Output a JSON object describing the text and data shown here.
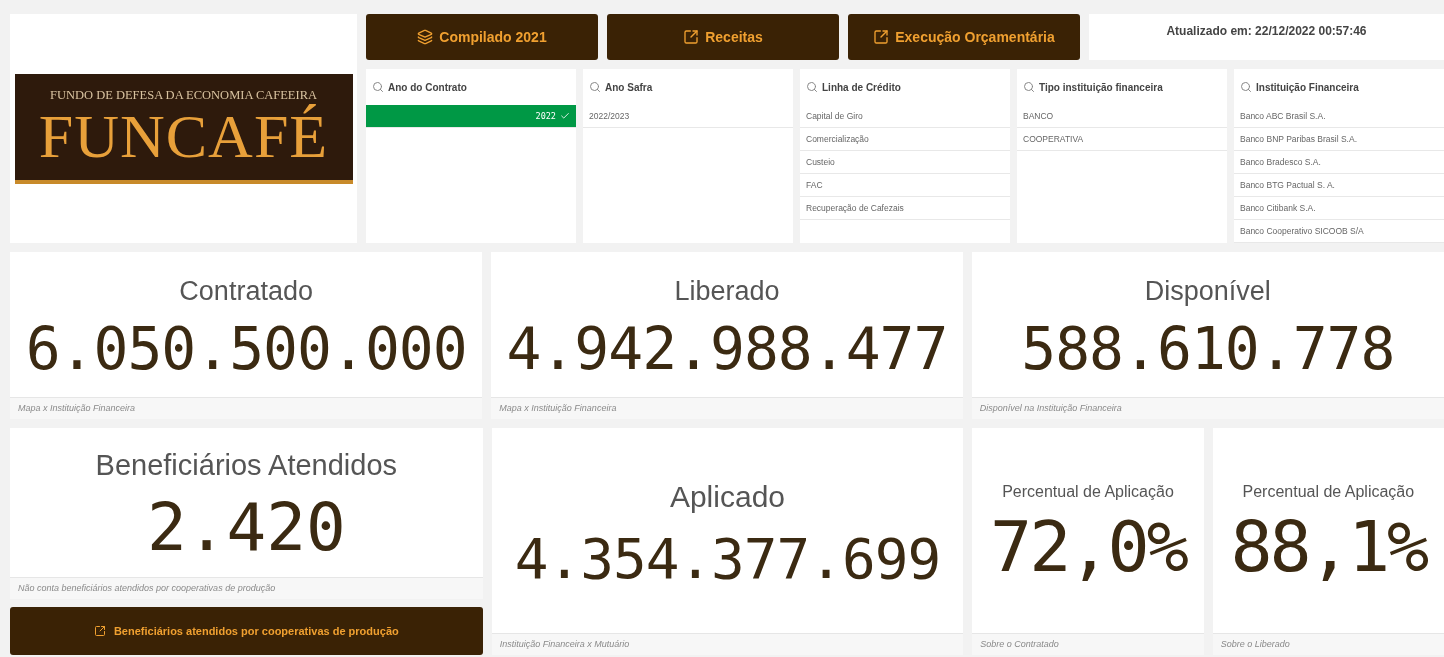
{
  "logo": {
    "subtitle": "FUNDO DE DEFESA DA ECONOMIA CAFEEIRA",
    "name": "FUNCAFÉ"
  },
  "nav_buttons": [
    {
      "label": "Compilado 2021",
      "kind": "layers"
    },
    {
      "label": "Receitas",
      "kind": "external"
    },
    {
      "label": "Execução Orçamentária",
      "kind": "external"
    }
  ],
  "updated": "Atualizado em: 22/12/2022 00:57:46",
  "filters": [
    {
      "title": "Ano do Contrato",
      "items": [
        {
          "label": "2022",
          "selected": true
        }
      ]
    },
    {
      "title": "Ano Safra",
      "items": [
        {
          "label": "2022/2023",
          "selected": false
        }
      ]
    },
    {
      "title": "Linha de Crédito",
      "items": [
        {
          "label": "Capital de Giro",
          "selected": false
        },
        {
          "label": "Comercialização",
          "selected": false
        },
        {
          "label": "Custeio",
          "selected": false
        },
        {
          "label": "FAC",
          "selected": false
        },
        {
          "label": "Recuperação de Cafezais",
          "selected": false
        }
      ]
    },
    {
      "title": "Tipo instituição financeira",
      "items": [
        {
          "label": "BANCO",
          "selected": false
        },
        {
          "label": "COOPERATIVA",
          "selected": false
        }
      ]
    },
    {
      "title": "Instituição Financeira",
      "items": [
        {
          "label": "Banco ABC Brasil S.A.",
          "selected": false
        },
        {
          "label": "Banco BNP Paribas Brasil S.A.",
          "selected": false
        },
        {
          "label": "Banco Bradesco S.A.",
          "selected": false
        },
        {
          "label": "Banco BTG Pactual S. A.",
          "selected": false
        },
        {
          "label": "Banco Citibank S.A.",
          "selected": false
        },
        {
          "label": "Banco Cooperativo SICOOB S/A",
          "selected": false
        }
      ]
    }
  ],
  "top_kpis": [
    {
      "title": "Contratado",
      "value": "6.050.500.000",
      "caption": "Mapa x Instituição Financeira"
    },
    {
      "title": "Liberado",
      "value": "4.942.988.477",
      "caption": "Mapa x Instituição Financeira"
    },
    {
      "title": "Disponível",
      "value": "588.610.778",
      "caption": "Disponível na Instituição Financeira"
    }
  ],
  "beneficiaries": {
    "title": "Beneficiários Atendidos",
    "value": "2.420",
    "caption": "Não conta beneficiários atendidos por cooperativas de produção"
  },
  "cooperatives_button": {
    "label": "Beneficiários atendidos por cooperativas de produção"
  },
  "bottom_kpis": [
    {
      "kind": "standard",
      "title": "Aplicado",
      "value": "4.354.377.699",
      "caption": "Instituição Financeira x Mutuário"
    },
    {
      "kind": "percent",
      "title": "Percentual de Aplicação",
      "value": "72,0%",
      "caption": "Sobre o Contratado"
    },
    {
      "kind": "percent",
      "title": "Percentual de Aplicação",
      "value": "88,1%",
      "caption": "Sobre o Liberado"
    }
  ]
}
